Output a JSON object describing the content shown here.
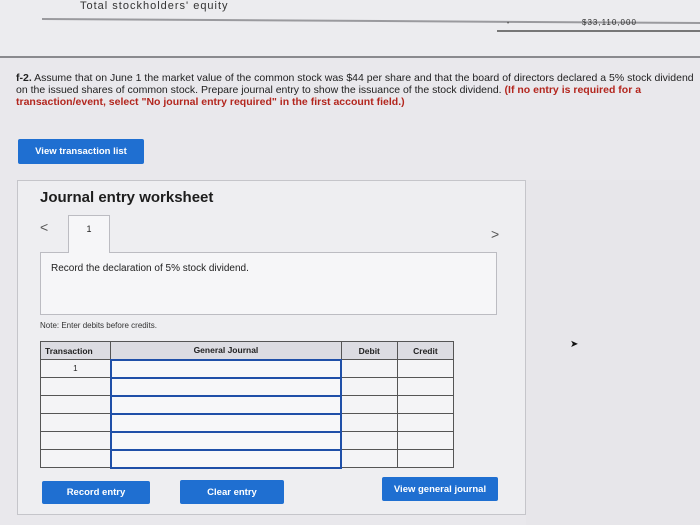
{
  "top": {
    "label": "Total stockholders' equity",
    "value": "$33,110,000"
  },
  "question": {
    "prefix": "f-2.",
    "text": " Assume that on June 1 the market value of the common stock was $44 per share and that the board of directors declared a 5% stock dividend on the issued shares of common stock. Prepare journal entry to show the issuance of the stock dividend.",
    "bold_note": " (If no entry is required for a transaction/event, select \"No journal entry required\" in the first account field.)"
  },
  "buttons": {
    "view_transaction_list": "View transaction list",
    "record_entry": "Record entry",
    "clear_entry": "Clear entry",
    "view_general_journal": "View general journal"
  },
  "worksheet": {
    "title": "Journal entry worksheet",
    "tab": "1",
    "description": "Record the declaration of 5% stock dividend.",
    "note": "Note: Enter debits before credits."
  },
  "table": {
    "headers": [
      "Transaction",
      "General Journal",
      "Debit",
      "Credit"
    ],
    "rows": [
      [
        "1",
        "",
        "",
        ""
      ],
      [
        "",
        "",
        "",
        ""
      ],
      [
        "",
        "",
        "",
        ""
      ],
      [
        "",
        "",
        "",
        ""
      ],
      [
        "",
        "",
        "",
        ""
      ],
      [
        "",
        "",
        "",
        ""
      ]
    ]
  },
  "icons": {
    "prev": "chevron-left-icon",
    "next": "chevron-right-icon"
  },
  "colors": {
    "accent": "#1f6fd1",
    "note_red": "#b3261e"
  }
}
